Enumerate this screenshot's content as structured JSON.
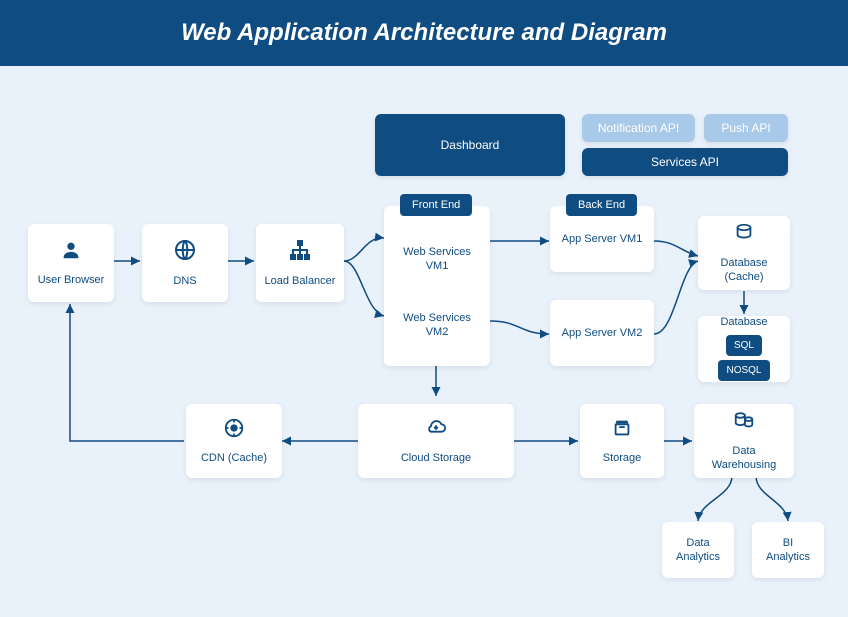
{
  "title": "Web Application Architecture and Diagram",
  "top_buttons": {
    "dashboard": "Dashboard",
    "notification_api": "Notification API",
    "push_api": "Push API",
    "services_api": "Services API"
  },
  "tags": {
    "front_end": "Front End",
    "back_end": "Back End"
  },
  "nodes": {
    "user_browser": "User Browser",
    "dns": "DNS",
    "load_balancer": "Load Balancer",
    "web_services_vm1": "Web Services VM1",
    "web_services_vm2": "Web Services VM2",
    "app_server_vm1": "App Server VM1",
    "app_server_vm2": "App Server VM2",
    "database_cache": "Database (Cache)",
    "database": "Database",
    "sql": "SQL",
    "nosql": "NOSQL",
    "cdn_cache": "CDN (Cache)",
    "cloud_storage": "Cloud Storage",
    "storage": "Storage",
    "data_warehousing": "Data Warehousing",
    "data_analytics": "Data Analytics",
    "bi_analytics": "BI Analytics"
  }
}
